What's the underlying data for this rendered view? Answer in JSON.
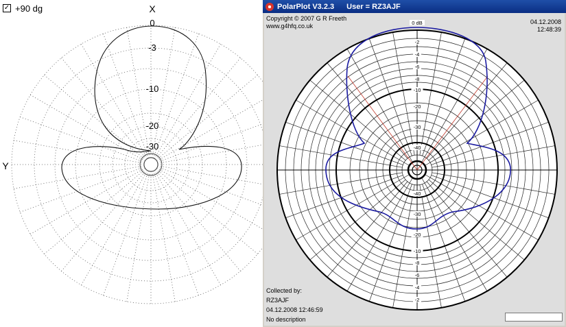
{
  "left_panel": {
    "checkbox_label": "+90 dg",
    "checkbox_checked": true,
    "axis_x_label": "X",
    "axis_y_label": "Y",
    "ring_labels": [
      "0",
      "-3",
      "-10",
      "-20",
      "-30"
    ]
  },
  "window": {
    "title": "PolarPlot V3.2.3",
    "user_label": "User = RZ3AJF",
    "copyright": "Copyright © 2007 G R Freeth",
    "website": "www.g4hfq.co.uk",
    "date": "04.12.2008",
    "time": "12:48:39",
    "collected_by_label": "Collected by:",
    "collector": "RZ3AJF",
    "collected_at": "04.12.2008 12:46:59",
    "description": "No description",
    "zero_db_label": "0 dB",
    "scale_labels": [
      "-2",
      "-4",
      "-6",
      "-8",
      "-10",
      "-20",
      "-30",
      "-40"
    ]
  },
  "colors": {
    "pattern_line": "#1a1aa0",
    "beam_lines": "#c0392b",
    "titlebar": "#0a2e83"
  }
}
